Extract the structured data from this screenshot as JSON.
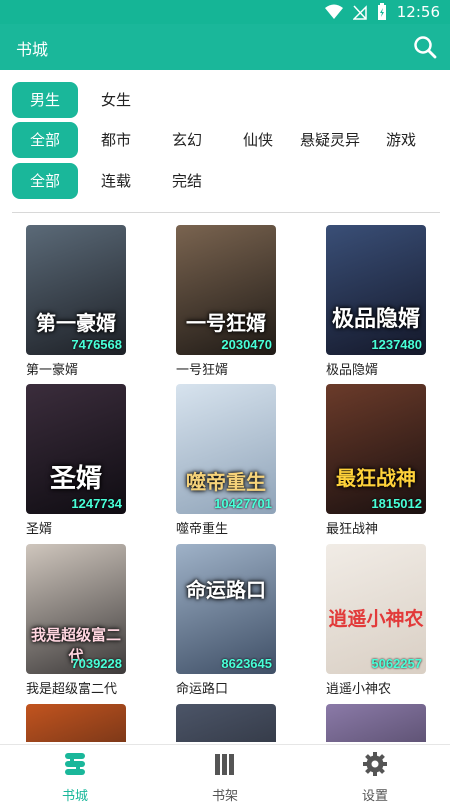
{
  "status": {
    "time": "12:56",
    "icons": [
      "wifi-icon",
      "no-signal-icon",
      "battery-charging-icon"
    ]
  },
  "appbar": {
    "title": "书城",
    "search_icon": "search-icon"
  },
  "filters": {
    "gender": {
      "selected": "男生",
      "options": [
        "女生"
      ]
    },
    "category": {
      "selected": "全部",
      "options": [
        "都市",
        "玄幻",
        "仙侠",
        "悬疑灵异",
        "游戏"
      ]
    },
    "status": {
      "selected": "全部",
      "options": [
        "连载",
        "完结"
      ]
    }
  },
  "books": [
    {
      "name": "第一豪婿",
      "cover_title": "第一豪婿",
      "count": "7476568",
      "bg1": "#5b6a78",
      "bg2": "#1d2026"
    },
    {
      "name": "一号狂婿",
      "cover_title": "一号狂婿",
      "count": "2030470",
      "bg1": "#7a6450",
      "bg2": "#1f1a16"
    },
    {
      "name": "极品隐婿",
      "cover_title": "极品隐婿",
      "count": "1237480",
      "bg1": "#3a4f77",
      "bg2": "#14182a"
    },
    {
      "name": "圣婿",
      "cover_title": "圣婿",
      "count": "1247734",
      "bg1": "#3b2d3c",
      "bg2": "#0f0c12"
    },
    {
      "name": "噬帝重生",
      "cover_title": "噬帝重生",
      "count": "10427701",
      "bg1": "#d7e3ee",
      "bg2": "#8fa3b8"
    },
    {
      "name": "最狂战神",
      "cover_title": "最狂战神",
      "count": "1815012",
      "bg1": "#6b3b2a",
      "bg2": "#1a1010"
    },
    {
      "name": "我是超级富二代",
      "cover_title": "我是超级富二代",
      "count": "7039228",
      "bg1": "#cfc6bd",
      "bg2": "#3d3a3a"
    },
    {
      "name": "命运路口",
      "cover_title": "命运路口",
      "count": "8623645",
      "bg1": "#9fb2c8",
      "bg2": "#3f4f66"
    },
    {
      "name": "逍遥小神农",
      "cover_title": "逍遥小神农",
      "count": "5062257",
      "bg1": "#f1ece6",
      "bg2": "#d9cfc4"
    },
    {
      "name": "",
      "cover_title": "",
      "count": "",
      "bg1": "#c2541f",
      "bg2": "#2a1710"
    },
    {
      "name": "",
      "cover_title": "",
      "count": "",
      "bg1": "#4c5568",
      "bg2": "#1a1d24"
    },
    {
      "name": "",
      "cover_title": "",
      "count": "",
      "bg1": "#8b7aa8",
      "bg2": "#2b2538"
    }
  ],
  "bottom_nav": [
    {
      "label": "书城",
      "icon": "bookstore-icon",
      "active": true
    },
    {
      "label": "书架",
      "icon": "bookshelf-icon",
      "active": false
    },
    {
      "label": "设置",
      "icon": "gear-icon",
      "active": false
    }
  ],
  "colors": {
    "accent": "#1ab79a",
    "count_text": "#49ffd8"
  }
}
